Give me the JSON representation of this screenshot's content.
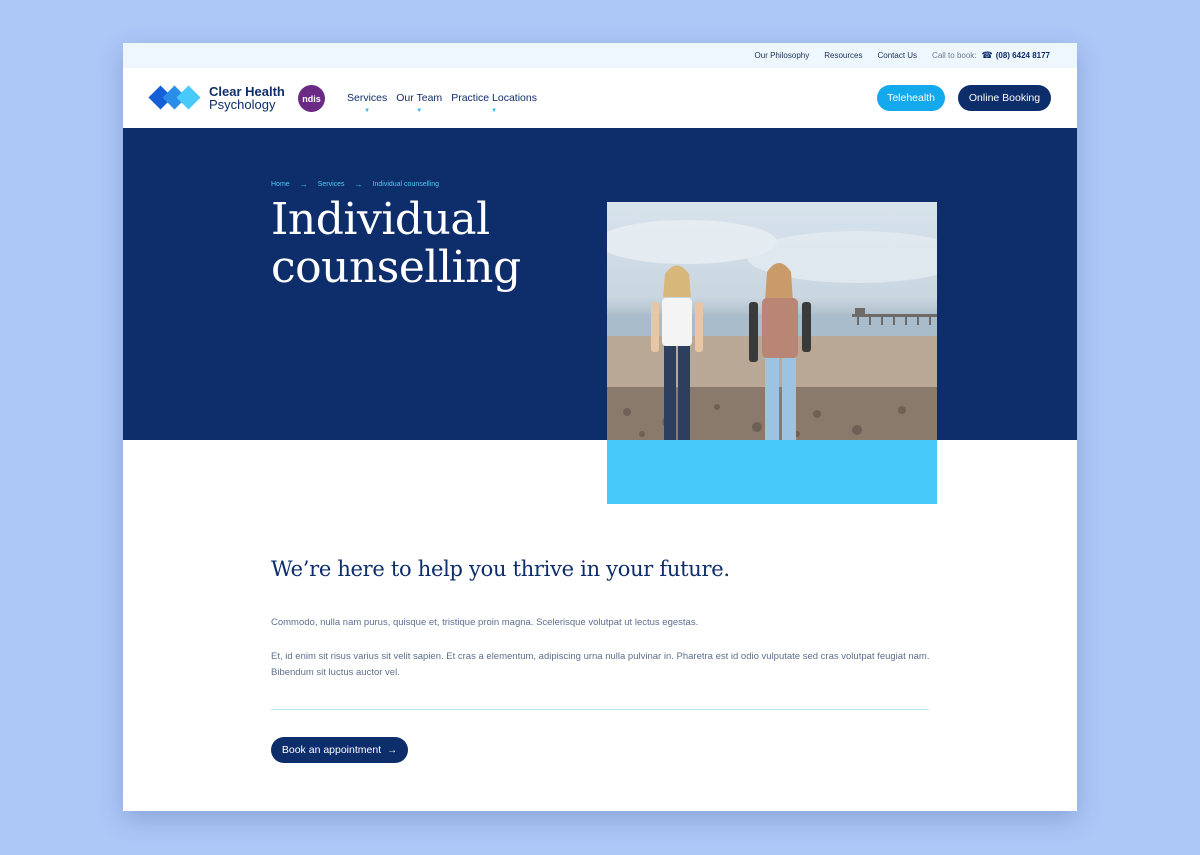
{
  "utility": {
    "links": [
      "Our Philosophy",
      "Resources",
      "Contact Us"
    ],
    "call_label": "Call to book:",
    "phone": "(08) 6424 8177"
  },
  "header": {
    "logo_line1": "Clear Health",
    "logo_line2": "Psychology",
    "ndis_badge": "ndis",
    "nav": [
      "Services",
      "Our Team",
      "Practice Locations"
    ],
    "telehealth": "Telehealth",
    "online_booking": "Online Booking"
  },
  "hero": {
    "breadcrumb": [
      "Home",
      "Services",
      "Individual counselling"
    ],
    "title": "Individual counselling"
  },
  "content": {
    "tagline": "We’re here to help you thrive in your future.",
    "para1": "Commodo, nulla nam purus, quisque et, tristique proin magna. Scelerisque volutpat ut lectus egestas.",
    "para2": "Et, id enim sit risus varius sit velit sapien. Et cras a elementum, adipiscing urna nulla pulvinar in. Pharetra est id odio vulputate sed cras volutpat feugiat nam. Bibendum sit luctus auctor vel.",
    "cta": "Book an appointment"
  },
  "colors": {
    "navy": "#0d2d6b",
    "sky": "#13a9ec",
    "accent": "#47cafa",
    "page_bg": "#adc8f7",
    "ndis_purple": "#6b2a83"
  },
  "icons": [
    "logo-diamonds-icon",
    "phone-icon",
    "chevron-down-icon",
    "arrow-right-icon"
  ]
}
